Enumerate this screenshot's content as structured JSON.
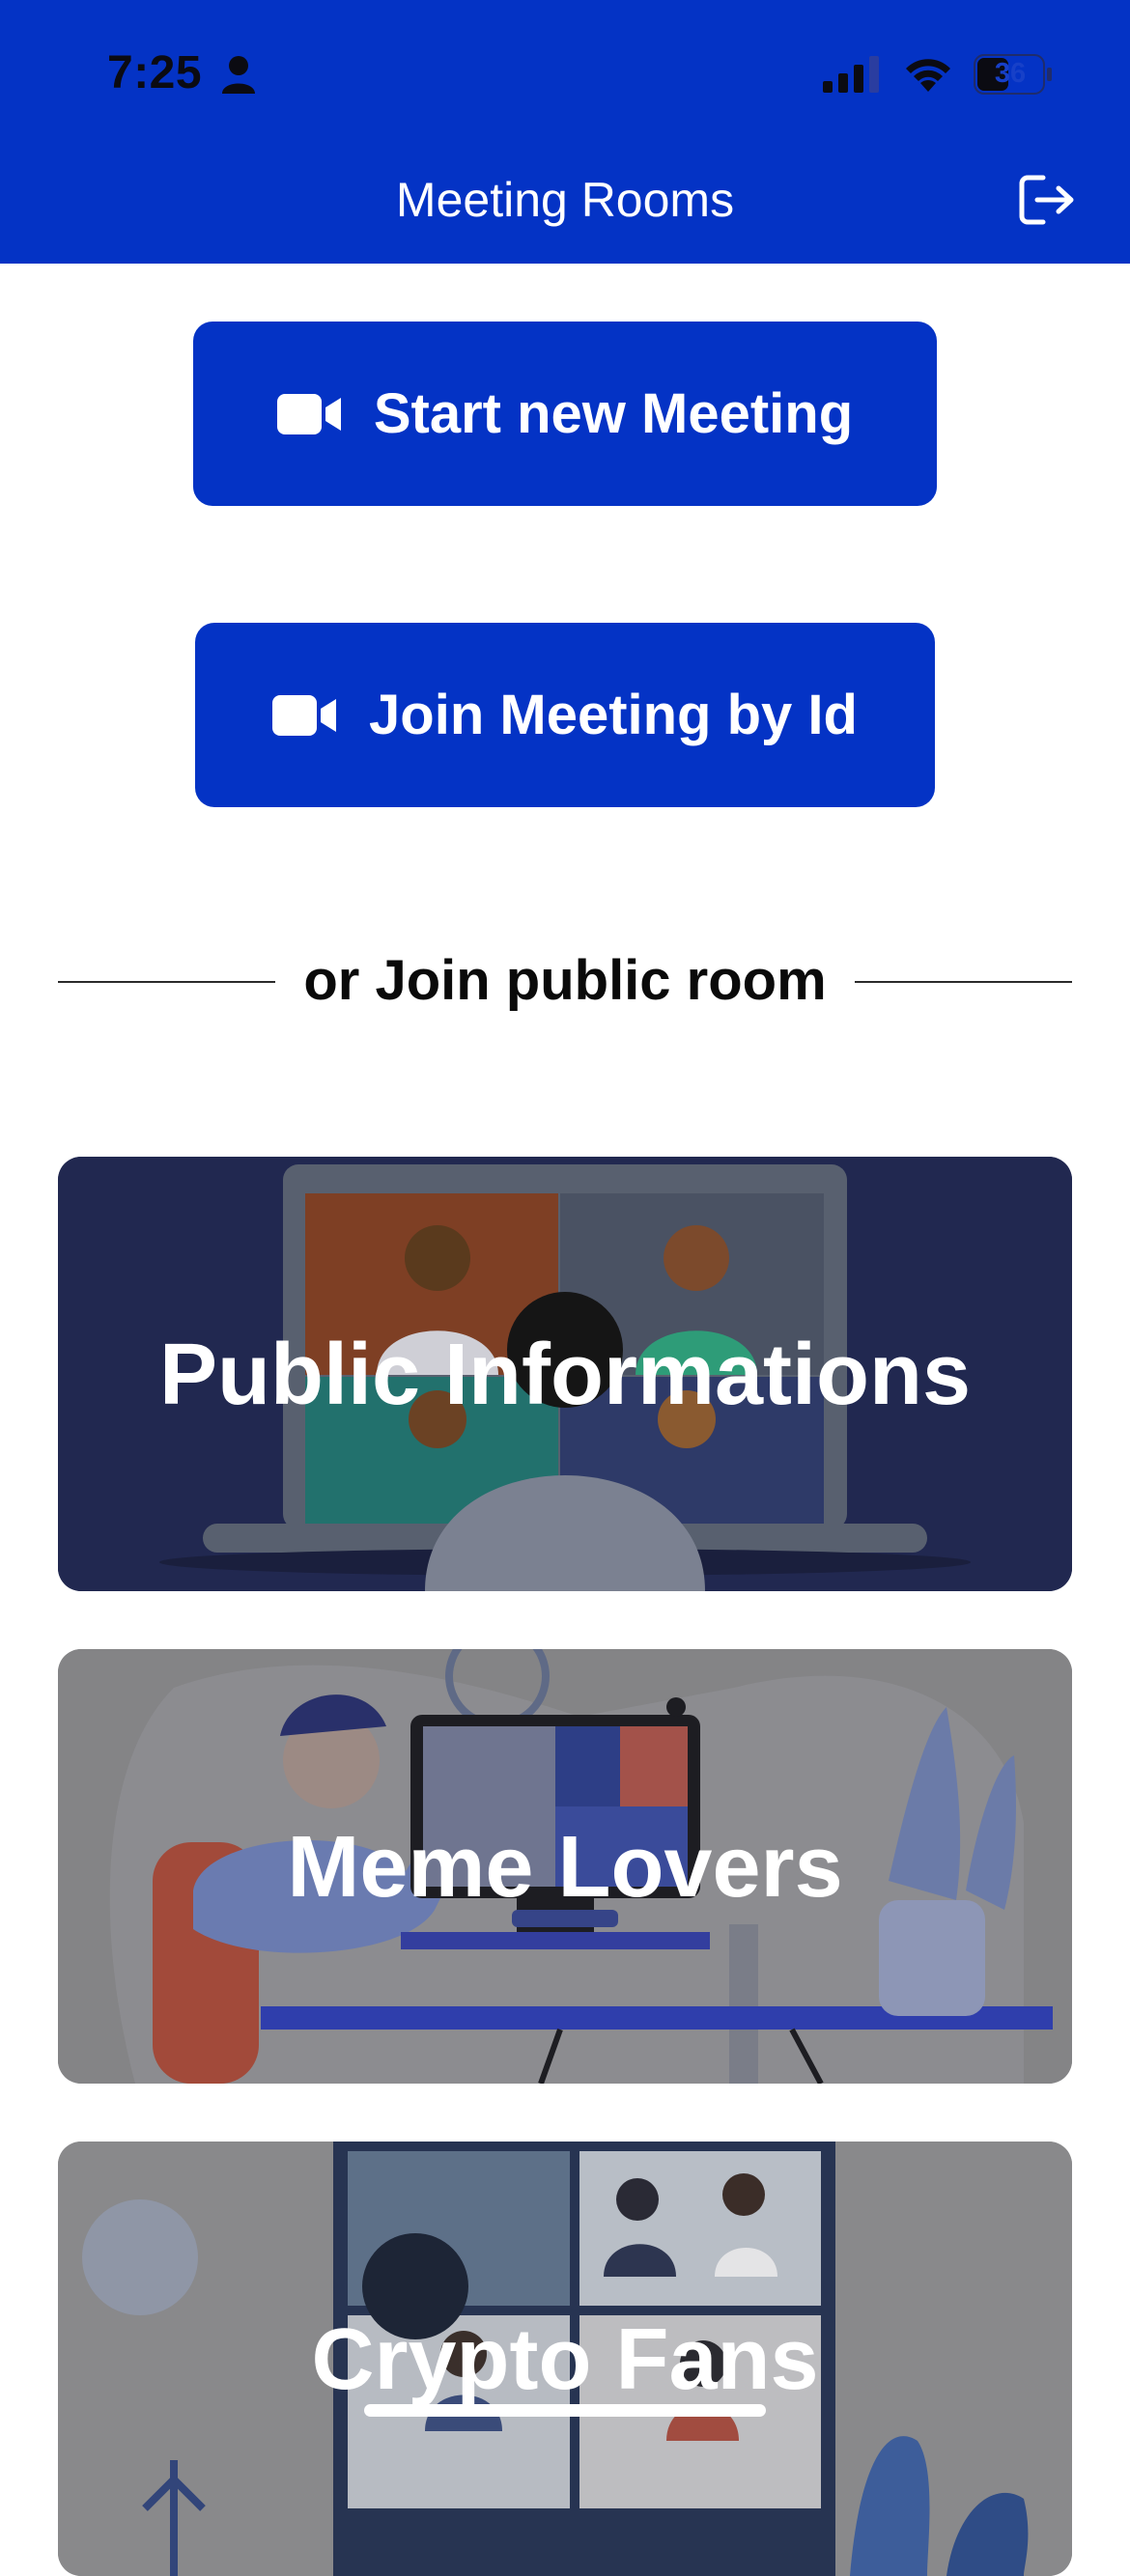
{
  "status_bar": {
    "time": "7:25",
    "battery": "36",
    "icons": [
      "person-icon",
      "signal-icon",
      "wifi-icon",
      "battery-icon"
    ]
  },
  "header": {
    "title": "Meeting Rooms",
    "logout_icon": "logout-icon"
  },
  "actions": {
    "start_label": "Start new Meeting",
    "join_label": "Join Meeting by Id",
    "icon": "video-camera-icon"
  },
  "divider": {
    "text": "or Join public room"
  },
  "rooms": [
    {
      "title": "Public Informations"
    },
    {
      "title": "Meme Lovers"
    },
    {
      "title": "Crypto Fans"
    }
  ],
  "colors": {
    "primary": "#0433c5",
    "room_1_bg": "#212850",
    "room_overlay": "#848486"
  }
}
